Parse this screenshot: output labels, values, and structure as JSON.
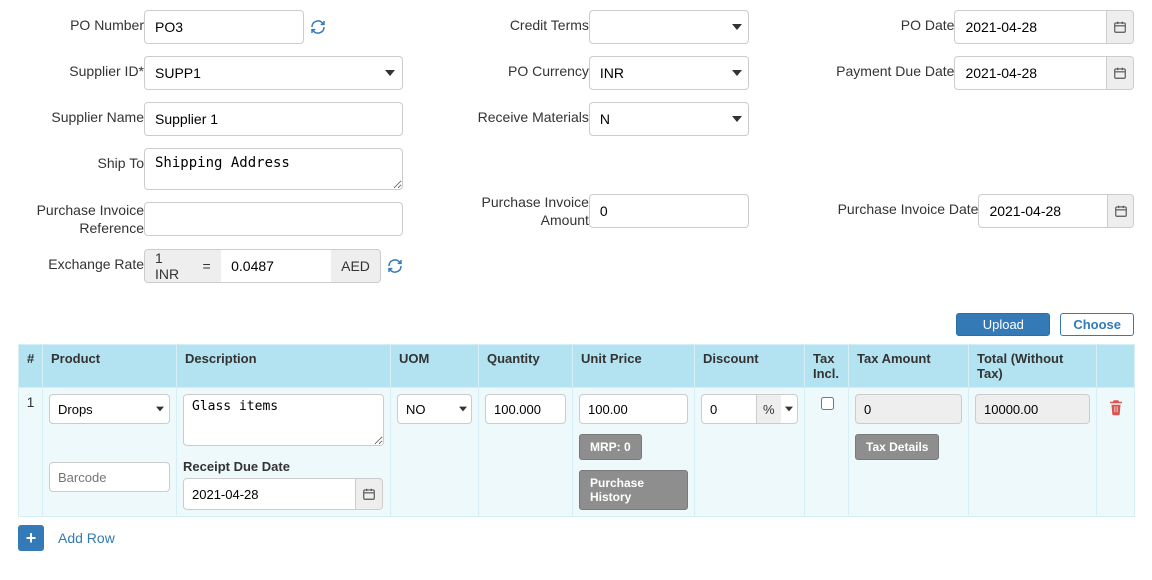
{
  "form": {
    "po_number": {
      "label": "PO Number",
      "value": "PO3"
    },
    "supplier_id": {
      "label": "Supplier ID*",
      "value": "SUPP1"
    },
    "supplier_name": {
      "label": "Supplier Name",
      "value": "Supplier 1"
    },
    "ship_to": {
      "label": "Ship To",
      "value": "Shipping Address"
    },
    "credit_terms": {
      "label": "Credit Terms",
      "value": ""
    },
    "po_currency": {
      "label": "PO Currency",
      "value": "INR"
    },
    "receive_materials": {
      "label": "Receive Materials",
      "value": "N"
    },
    "po_date": {
      "label": "PO Date",
      "value": "2021-04-28"
    },
    "payment_due_date": {
      "label": "Payment Due Date",
      "value": "2021-04-28"
    },
    "purchase_invoice_reference": {
      "label": "Purchase Invoice Reference",
      "value": ""
    },
    "purchase_invoice_amount": {
      "label": "Purchase Invoice Amount",
      "value": "0"
    },
    "purchase_invoice_date": {
      "label": "Purchase Invoice Date",
      "value": "2021-04-28"
    },
    "exchange_rate": {
      "label": "Exchange Rate",
      "from": "1 INR",
      "eq": "=",
      "value": "0.0487",
      "to": "AED"
    }
  },
  "toolbar": {
    "upload": "Upload",
    "choose": "Choose"
  },
  "table": {
    "headers": {
      "num": "#",
      "product": "Product",
      "description": "Description",
      "uom": "UOM",
      "quantity": "Quantity",
      "unit_price": "Unit Price",
      "discount": "Discount",
      "tax_incl": "Tax Incl.",
      "tax_amount": "Tax Amount",
      "total": "Total (Without Tax)"
    },
    "rows": [
      {
        "num": "1",
        "product": "Drops",
        "barcode_placeholder": "Barcode",
        "description": "Glass items",
        "receipt_due_date_label": "Receipt Due Date",
        "receipt_due_date": "2021-04-28",
        "uom": "NO",
        "quantity": "100.000",
        "unit_price": "100.00",
        "mrp_label": "MRP: 0",
        "purchase_history_label": "Purchase History",
        "discount_value": "0",
        "discount_unit": "%",
        "tax_incl": false,
        "tax_amount": "0",
        "tax_details_label": "Tax Details",
        "total": "10000.00"
      }
    ]
  },
  "addrow": {
    "label": "Add Row"
  }
}
